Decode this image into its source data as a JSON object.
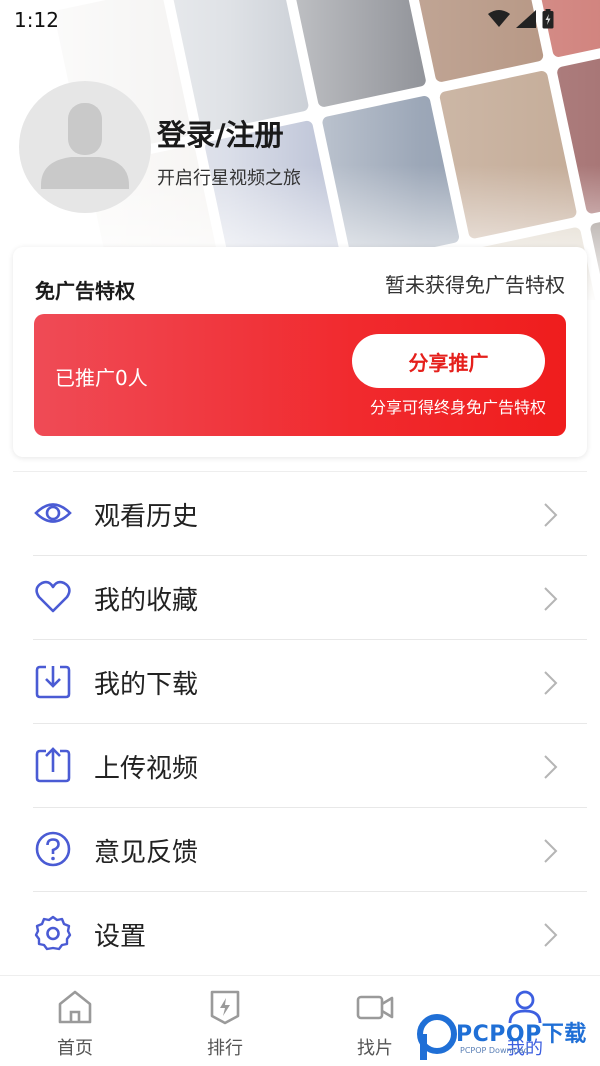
{
  "status_bar": {
    "time": "1:12"
  },
  "profile": {
    "login_title": "登录/注册",
    "subtitle": "开启行星视频之旅"
  },
  "privilege_card": {
    "title": "免广告特权",
    "status": "暂未获得免广告特权",
    "promo_count": "已推广0人",
    "share_button": "分享推广",
    "share_note": "分享可得终身免广告特权"
  },
  "menu": {
    "items": [
      {
        "label": "观看历史",
        "icon": "eye-icon"
      },
      {
        "label": "我的收藏",
        "icon": "heart-icon"
      },
      {
        "label": "我的下载",
        "icon": "download-icon"
      },
      {
        "label": "上传视频",
        "icon": "upload-icon"
      },
      {
        "label": "意见反馈",
        "icon": "question-icon"
      },
      {
        "label": "设置",
        "icon": "gear-icon"
      }
    ]
  },
  "bottom_nav": {
    "items": [
      {
        "label": "首页",
        "icon": "home-icon"
      },
      {
        "label": "排行",
        "icon": "rank-icon"
      },
      {
        "label": "找片",
        "icon": "video-camera-icon"
      },
      {
        "label": "我的",
        "icon": "user-icon",
        "active": true
      }
    ]
  },
  "watermark": {
    "brand": "PCPOP下载",
    "small": "PCPOP Download"
  },
  "colors": {
    "accent_blue": "#3d5fe0",
    "promo_red": "#f12a2e",
    "icon_blue": "#4a5bd4"
  }
}
